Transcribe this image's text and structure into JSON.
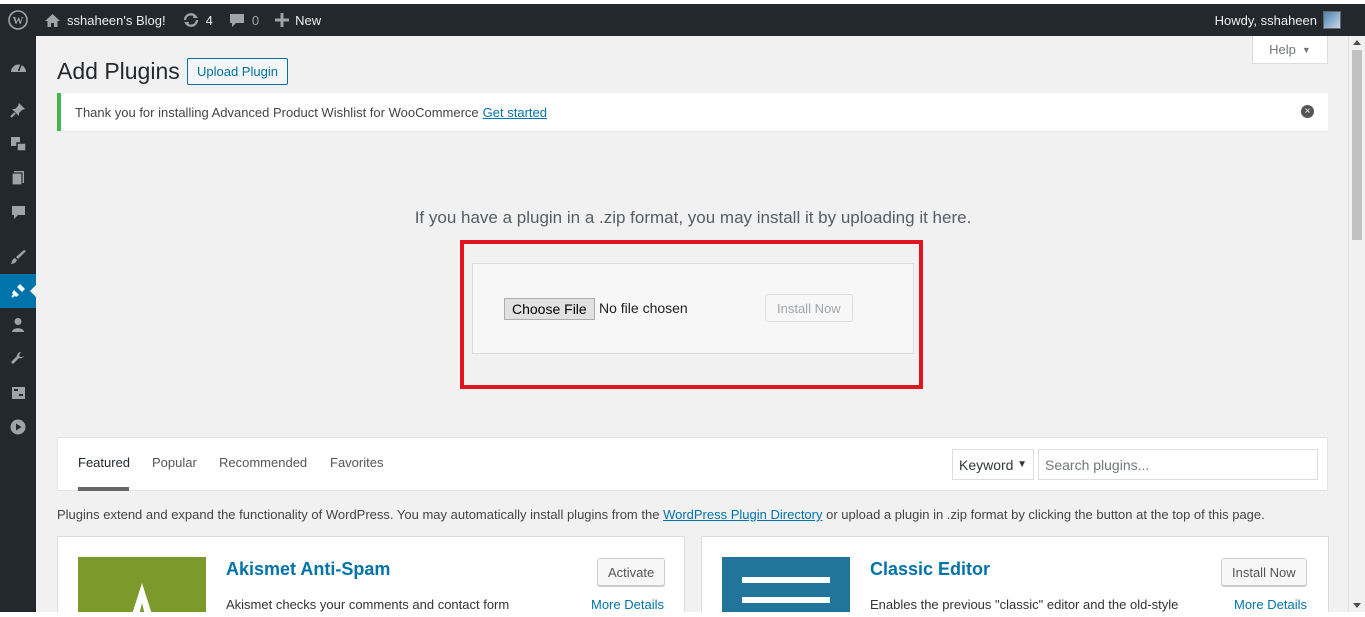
{
  "adminbar": {
    "site_name": "sshaheen's Blog!",
    "updates_count": "4",
    "comments_count": "0",
    "new_label": "New",
    "howdy": "Howdy, sshaheen"
  },
  "help": {
    "label": "Help",
    "caret": "▼"
  },
  "page": {
    "title": "Add Plugins",
    "upload_button": "Upload Plugin"
  },
  "notice": {
    "text": "Thank you for installing Advanced Product Wishlist for WooCommerce",
    "link": "Get started"
  },
  "upload": {
    "intro": "If you have a plugin in a .zip format, you may install it by uploading it here.",
    "choose_file": "Choose File",
    "no_file": "No file chosen",
    "install_now": "Install Now"
  },
  "filter": {
    "tabs": [
      "Featured",
      "Popular",
      "Recommended",
      "Favorites"
    ],
    "keyword_select": "Keyword",
    "search_placeholder": "Search plugins..."
  },
  "description": {
    "before": "Plugins extend and expand the functionality of WordPress. You may automatically install plugins from the ",
    "link": "WordPress Plugin Directory",
    "after": " or upload a plugin in .zip format by clicking the button at the top of this page."
  },
  "cards": [
    {
      "title": "Akismet Anti-Spam",
      "desc": "Akismet checks your comments and contact form",
      "button": "Activate",
      "more": "More Details",
      "color": "#7b9a2b"
    },
    {
      "title": "Classic Editor",
      "desc": "Enables the previous \"classic\" editor and the old-style",
      "button": "Install Now",
      "more": "More Details",
      "color": "#21759b"
    }
  ],
  "colors": {
    "accent": "#0073aa",
    "adminbar": "#23282d",
    "notice_success": "#46b450",
    "highlight": "#e2141f"
  }
}
